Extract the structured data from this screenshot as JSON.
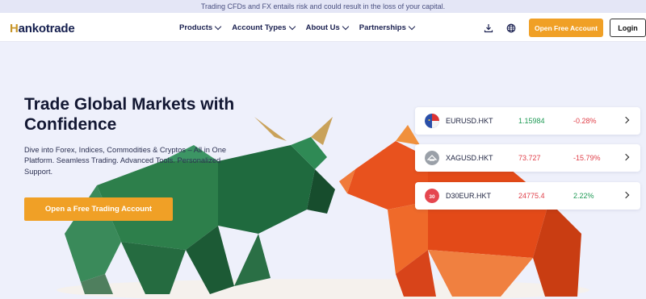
{
  "risk_warning": "Trading CFDs and FX entails risk and could result in the loss of your capital.",
  "logo": {
    "first": "H",
    "rest": "ankotrade"
  },
  "nav": {
    "items": [
      {
        "label": "Products"
      },
      {
        "label": "Account Types"
      },
      {
        "label": "About Us"
      },
      {
        "label": "Partnerships"
      }
    ],
    "open_account_label": "Open Free Account",
    "login_label": "Login"
  },
  "hero": {
    "title": "Trade Global Markets with Confidence",
    "subtitle": "Dive into Forex, Indices, Commodities & Cryptos – All in One Platform. Seamless Trading. Advanced Tools. Personalized Support.",
    "cta_label": "Open a Free Trading Account"
  },
  "tickers": [
    {
      "symbol": "EURUSD.HKT",
      "price": "1.15984",
      "change": "-0.28%",
      "icon": "eu-us-flag-icon"
    },
    {
      "symbol": "XAGUSD.HKT",
      "price": "73.727",
      "change": "-15.79%",
      "icon": "silver-icon"
    },
    {
      "symbol": "D30EUR.HKT",
      "price": "24775.4",
      "change": "2.22%",
      "icon": "dax30-icon"
    }
  ],
  "colors": {
    "accent": "#f0a026",
    "positive": "#1f9a55",
    "negative": "#e0404a",
    "bull": "#2f7a4a",
    "bear": "#e8521e"
  }
}
